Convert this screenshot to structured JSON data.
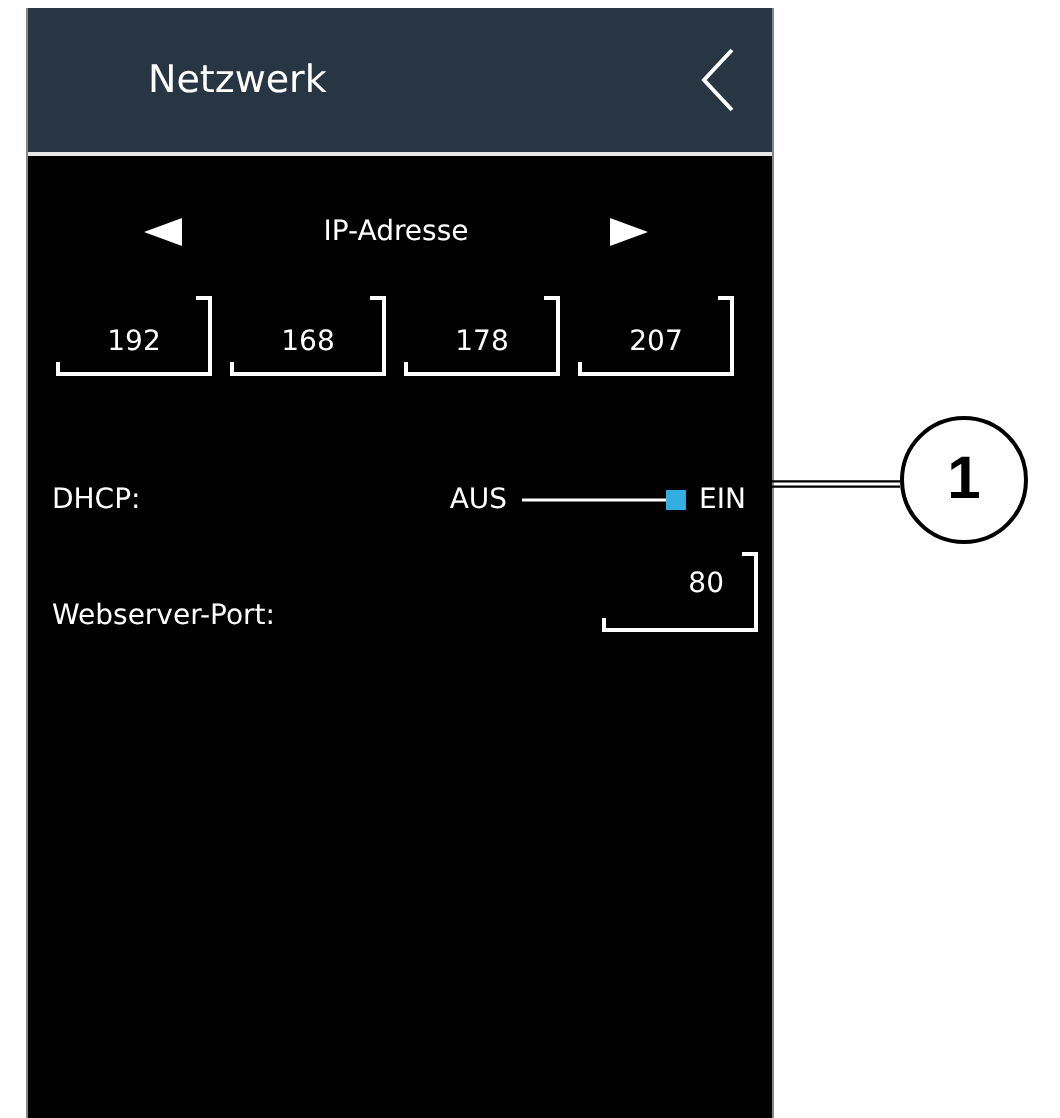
{
  "header": {
    "title": "Netzwerk"
  },
  "selector": {
    "label": "IP-Adresse"
  },
  "ip_octets": [
    "192",
    "168",
    "178",
    "207"
  ],
  "dhcp": {
    "label": "DHCP:",
    "off_label": "AUS",
    "on_label": "EIN",
    "on": true
  },
  "port": {
    "label": "Webserver-Port:",
    "value": "80"
  },
  "callouts": [
    {
      "label": "1"
    }
  ]
}
